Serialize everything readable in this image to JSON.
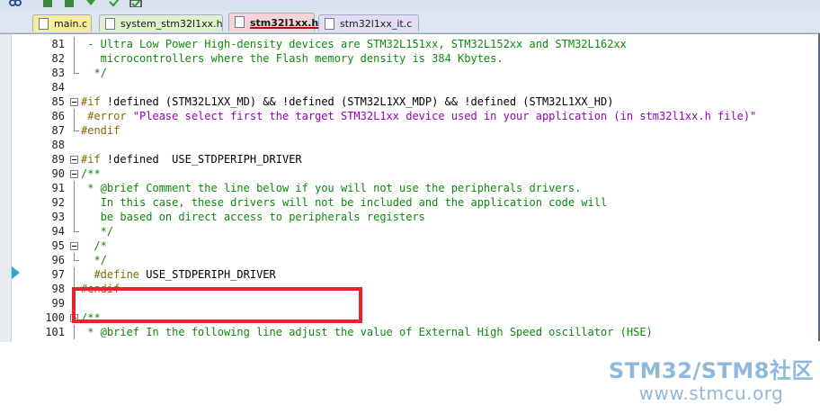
{
  "tabs": [
    {
      "label": "main.c",
      "color": "#f7ec9a",
      "active": false
    },
    {
      "label": "system_stm32l1xx.h",
      "color": "#dff0cc",
      "active": false
    },
    {
      "label": "stm32l1xx.h",
      "color": "#f6d3d6",
      "active": true
    },
    {
      "label": "stm32l1xx_it.c",
      "color": "#e3dcf5",
      "active": false
    }
  ],
  "editor": {
    "lines": [
      {
        "num": "81",
        "text": " - Ultra Low Power High-density devices are STM32L151xx, STM32L152xx and STM32L162xx",
        "kind": "comment",
        "fold": "line"
      },
      {
        "num": "82",
        "text": "   microcontrollers where the Flash memory density is 384 Kbytes.",
        "kind": "comment",
        "fold": "line"
      },
      {
        "num": "83",
        "text": "  */",
        "kind": "comment",
        "fold": "end"
      },
      {
        "num": "84",
        "text": "",
        "kind": "blank",
        "fold": ""
      },
      {
        "num": "85",
        "text": "#if !defined (STM32L1XX_MD) && !defined (STM32L1XX_MDP) && !defined (STM32L1XX_HD)",
        "kind": "if",
        "fold": "box"
      },
      {
        "num": "86",
        "text": " #error \"Please select first the target STM32L1xx device used in your application (in stm32l1xx.h file)\"",
        "kind": "error",
        "fold": "line"
      },
      {
        "num": "87",
        "text": "#endif",
        "kind": "directive",
        "fold": "end"
      },
      {
        "num": "88",
        "text": "",
        "kind": "blank",
        "fold": ""
      },
      {
        "num": "89",
        "text": "#if !defined  USE_STDPERIPH_DRIVER",
        "kind": "if",
        "fold": "box"
      },
      {
        "num": "90",
        "text": "/**",
        "kind": "comment",
        "fold": "box"
      },
      {
        "num": "91",
        "text": " * @brief Comment the line below if you will not use the peripherals drivers.",
        "kind": "comment",
        "fold": "line"
      },
      {
        "num": "92",
        "text": "   In this case, these drivers will not be included and the application code will",
        "kind": "comment",
        "fold": "line"
      },
      {
        "num": "93",
        "text": "   be based on direct access to peripherals registers",
        "kind": "comment",
        "fold": "line"
      },
      {
        "num": "94",
        "text": "   */",
        "kind": "comment",
        "fold": "end"
      },
      {
        "num": "95",
        "text": "  /*",
        "kind": "comment",
        "fold": "box"
      },
      {
        "num": "96",
        "text": "  */",
        "kind": "comment",
        "fold": "end"
      },
      {
        "num": "97",
        "text": "  #define USE_STDPERIPH_DRIVER",
        "kind": "define",
        "fold": "line"
      },
      {
        "num": "98",
        "text": "#endif",
        "kind": "directive",
        "fold": "end"
      },
      {
        "num": "99",
        "text": "",
        "kind": "blank",
        "fold": ""
      },
      {
        "num": "100",
        "text": "/**",
        "kind": "comment",
        "fold": "box"
      },
      {
        "num": "101",
        "text": " * @brief In the following line adjust the value of External High Speed oscillator (HSE)",
        "kind": "comment",
        "fold": "line"
      }
    ]
  },
  "watermark": {
    "line1": "STM32/STM8社区",
    "line2": "www.stmcu.org"
  },
  "colors": {
    "comment": "#0b8a0b",
    "directive": "#816a00",
    "string": "#9800b8",
    "highlight_box": "#e8222e",
    "watermark": "#8fb9dc"
  }
}
